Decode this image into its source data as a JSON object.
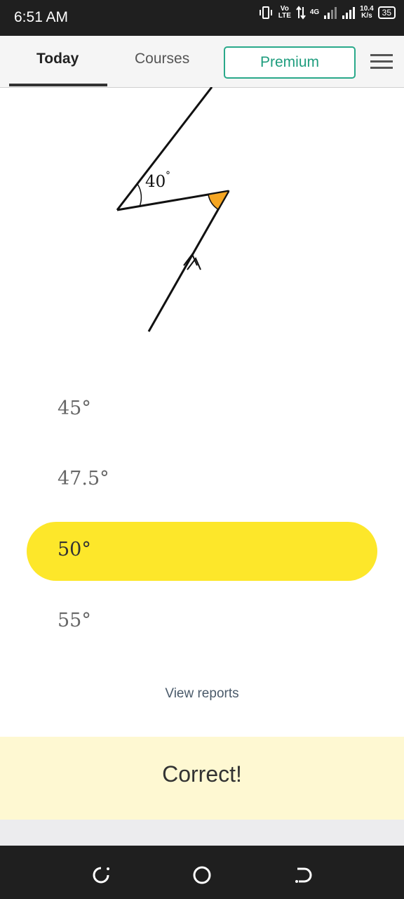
{
  "status_bar": {
    "time": "6:51 AM",
    "volte": "Vo LTE",
    "network": "4G",
    "speed_value": "10.4",
    "speed_unit": "K/s",
    "battery": "35"
  },
  "nav": {
    "tabs": [
      {
        "label": "Today"
      },
      {
        "label": "Courses"
      }
    ],
    "premium_label": "Premium",
    "menu_icon": "hamburger-menu-icon"
  },
  "diagram": {
    "angle_label": "40",
    "degree_symbol": "°",
    "highlight_color": "#f5a623"
  },
  "options": [
    {
      "label": "45°"
    },
    {
      "label": "47.5°"
    },
    {
      "label": "50°",
      "selected": true
    },
    {
      "label": "55°"
    }
  ],
  "view_reports_label": "View reports",
  "result_banner": {
    "text": "Correct!"
  },
  "colors": {
    "accent_teal": "#2aa98a",
    "selected_yellow": "#fde72a",
    "banner_bg": "#fef8d2"
  }
}
